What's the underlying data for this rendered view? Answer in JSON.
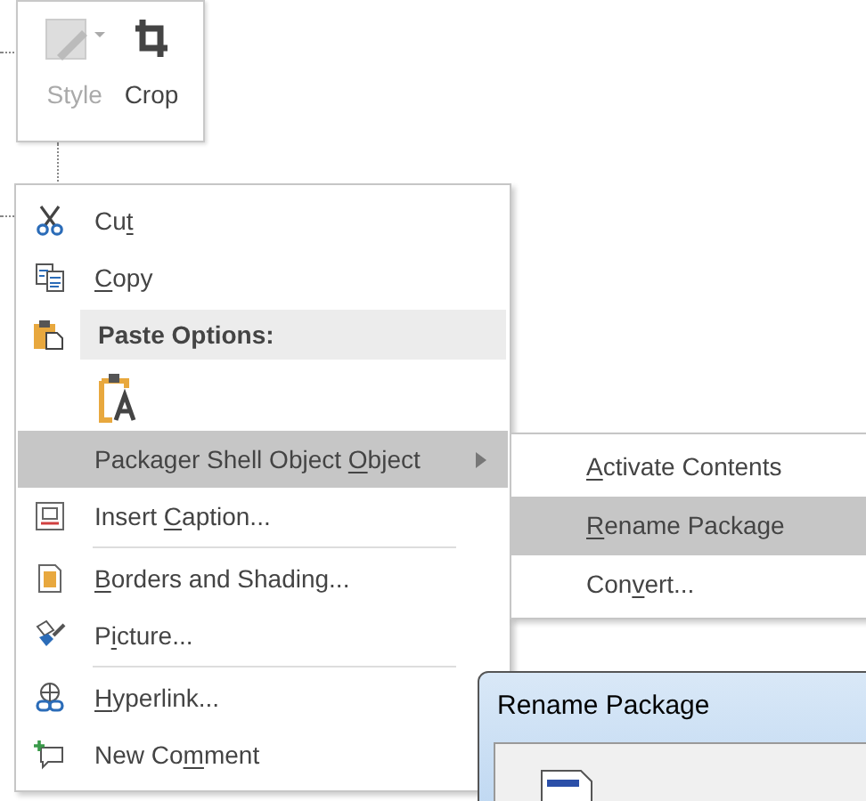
{
  "mini_toolbar": {
    "buttons": [
      {
        "kind": "style",
        "label": "Style",
        "disabled": true
      },
      {
        "kind": "crop",
        "label": "Crop",
        "disabled": false
      }
    ]
  },
  "context_menu": {
    "items": [
      {
        "kind": "cut",
        "pre": "Cu",
        "key": "t",
        "selected": false
      },
      {
        "kind": "copy",
        "key": "C",
        "post": "opy",
        "selected": false
      },
      {
        "kind": "paste_header",
        "label": "Paste Options:"
      },
      {
        "kind": "paste_options"
      },
      {
        "kind": "submenu",
        "pre": "Packager Shell Object ",
        "key": "O",
        "post": "bject",
        "selected": true
      },
      {
        "kind": "caption",
        "pre": "Insert ",
        "key": "C",
        "post": "aption...",
        "selected": false
      },
      {
        "kind": "separator"
      },
      {
        "kind": "borders",
        "key": "B",
        "post": "orders and Shading...",
        "selected": false
      },
      {
        "kind": "picture",
        "pre": "P",
        "key": "i",
        "post": "cture...",
        "selected": false
      },
      {
        "kind": "separator"
      },
      {
        "kind": "hyperlink",
        "key": "H",
        "post": "yperlink...",
        "selected": false
      },
      {
        "kind": "comment",
        "pre": "New Co",
        "key": "m",
        "post": "ment",
        "selected": false
      }
    ]
  },
  "submenu": {
    "items": [
      {
        "key": "A",
        "post": "ctivate Contents",
        "selected": false
      },
      {
        "key": "R",
        "post": "ename Package",
        "selected": true
      },
      {
        "pre": "Con",
        "key": "v",
        "post": "ert...",
        "selected": false
      }
    ]
  },
  "dialog": {
    "title": "Rename Package"
  }
}
